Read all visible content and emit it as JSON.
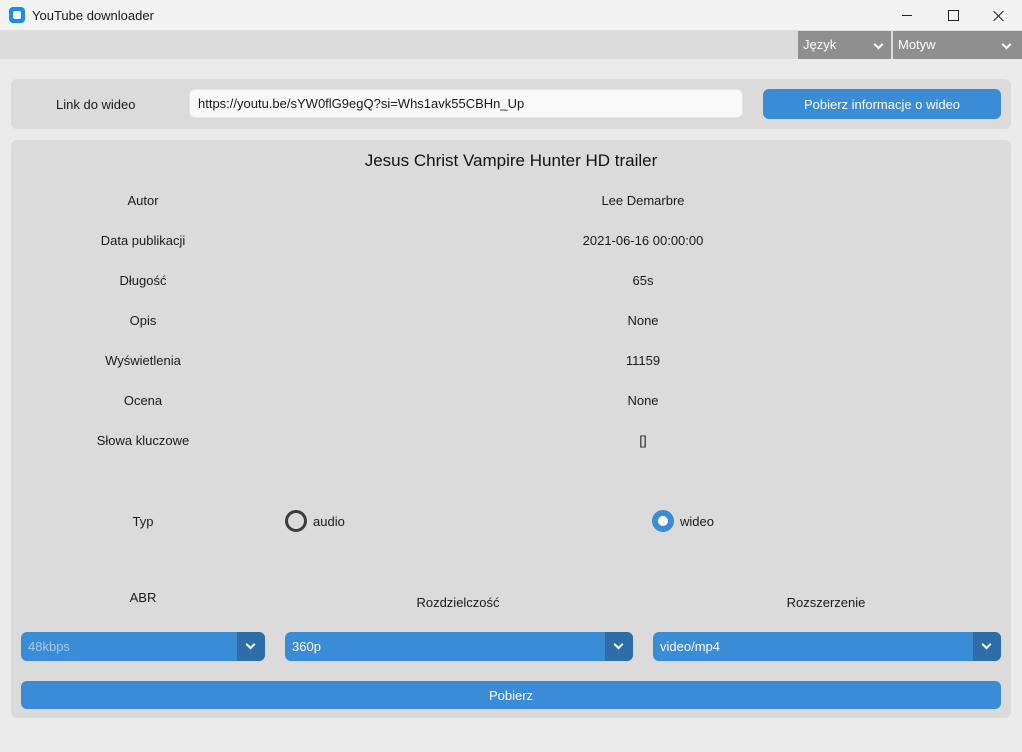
{
  "window": {
    "title": "YouTube downloader",
    "icon": "app-icon"
  },
  "menubar": {
    "language": "Język",
    "theme": "Motyw"
  },
  "link_panel": {
    "label": "Link do wideo",
    "url_value": "https://youtu.be/sYW0flG9egQ?si=Whs1avk55CBHn_Up",
    "fetch_button": "Pobierz informacje o wideo"
  },
  "video": {
    "title": "Jesus Christ Vampire Hunter HD trailer",
    "info": [
      {
        "label": "Autor",
        "value": "Lee Demarbre"
      },
      {
        "label": "Data publikacji",
        "value": "2021-06-16 00:00:00"
      },
      {
        "label": "Długość",
        "value": "65s"
      },
      {
        "label": "Opis",
        "value": "None"
      },
      {
        "label": "Wyświetlenia",
        "value": "11159"
      },
      {
        "label": "Ocena",
        "value": "None"
      },
      {
        "label": "Słowa kluczowe",
        "value": "[]"
      }
    ]
  },
  "options": {
    "type_label": "Typ",
    "type_audio": "audio",
    "type_video": "wideo",
    "selected_type": "wideo",
    "abr_label": "ABR",
    "resolution_label": "Rozdzielczość",
    "extension_label": "Rozszerzenie",
    "abr_value": "48kbps",
    "resolution_value": "360p",
    "extension_value": "video/mp4"
  },
  "download_button": "Pobierz",
  "colors": {
    "accent": "#3a8cd6",
    "accent_dark": "#2e6ea8",
    "panel": "#dbdbdb",
    "menu_select": "#8f8f8f"
  }
}
